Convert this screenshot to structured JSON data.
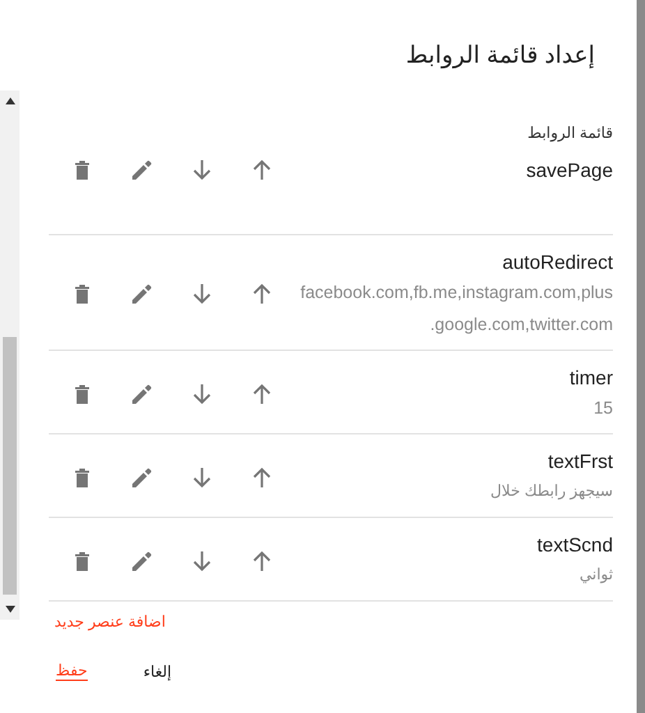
{
  "dialog": {
    "title": "إعداد قائمة الروابط"
  },
  "section_label": "قائمة الروابط",
  "items": [
    {
      "name": "savePage"
    },
    {
      "name": "autoRedirect",
      "value_lines": [
        "facebook.com,fb.me,instagram.com,plus",
        ".google.com,twitter.com"
      ]
    },
    {
      "name": "timer",
      "value_lines": [
        "15"
      ]
    },
    {
      "name": "textFrst",
      "value_lines": [
        "سيجهز رابطك خلال"
      ]
    },
    {
      "name": "textScnd",
      "value_lines": [
        "ثواني"
      ]
    }
  ],
  "add_link": "اضافة عنصر جديد",
  "buttons": [
    {
      "label": "إلغاء",
      "kind": "secondary"
    },
    {
      "label": "حفظ",
      "kind": "primary"
    }
  ]
}
